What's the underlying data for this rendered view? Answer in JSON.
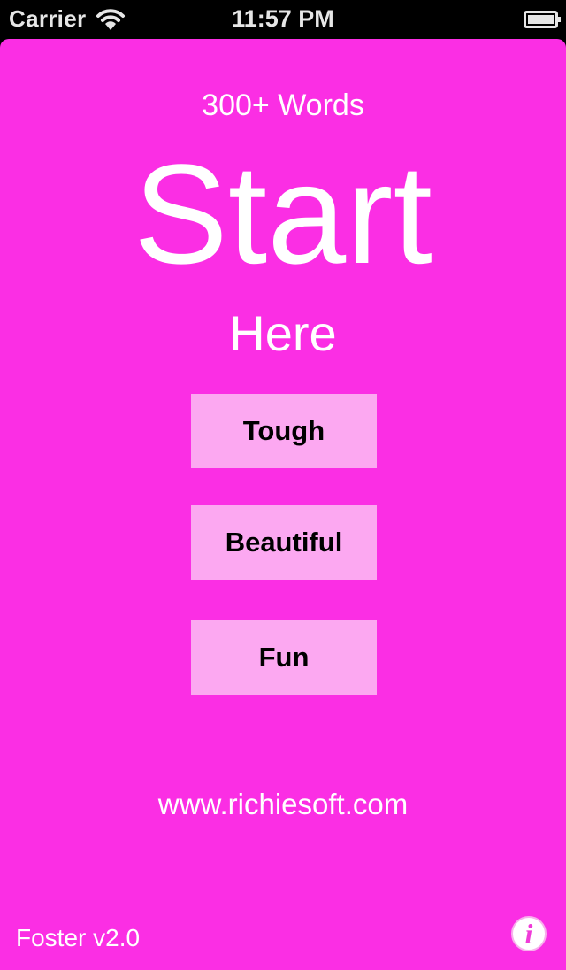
{
  "status_bar": {
    "carrier": "Carrier",
    "time": "11:57 PM",
    "wifi_icon": "wifi-icon",
    "battery_icon": "battery-icon"
  },
  "main": {
    "subtitle": "300+ Words",
    "hero_title": "Start",
    "hero_sub": "Here",
    "buttons": [
      {
        "label": "Tough"
      },
      {
        "label": "Beautiful"
      },
      {
        "label": "Fun"
      }
    ],
    "website": "www.richiesoft.com"
  },
  "footer": {
    "version": "Foster v2.0",
    "info_icon": "info-icon",
    "info_glyph": "i"
  },
  "colors": {
    "background": "#fb2ee4",
    "button": "#fca8f1",
    "text": "#ffffff",
    "button_text": "#000000"
  }
}
